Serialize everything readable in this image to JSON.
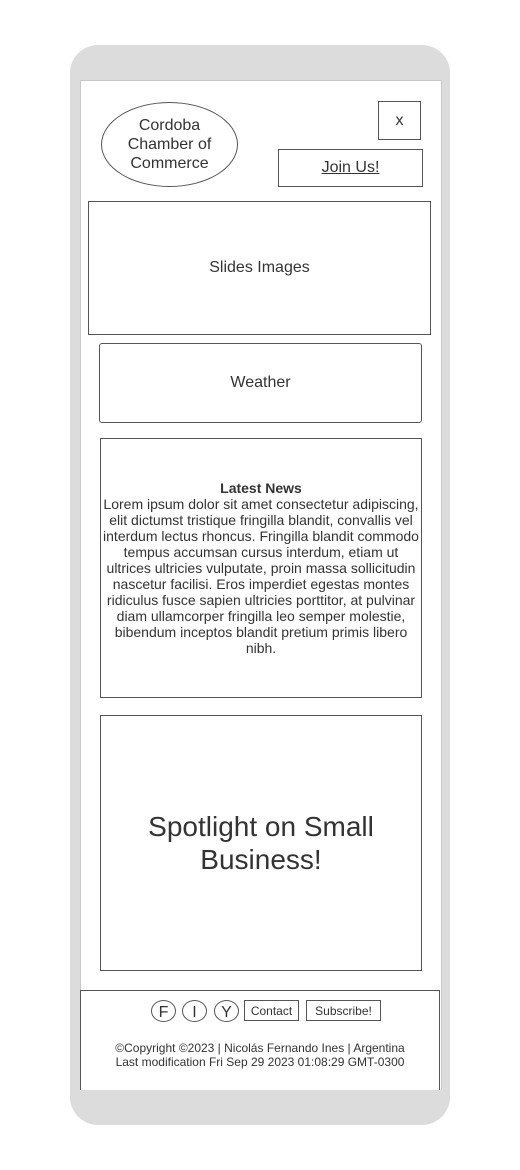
{
  "header": {
    "logo_text": "Cordoba Chamber of Commerce",
    "close_label": "x",
    "join_label": "Join Us!"
  },
  "main": {
    "slides_label": "Slides Images",
    "weather_label": "Weather",
    "news": {
      "title": "Latest News",
      "body": "Lorem ipsum dolor sit amet consectetur adipiscing, elit dictumst tristique fringilla blandit, convallis vel interdum lectus rhoncus. Fringilla blandit commodo tempus accumsan cursus interdum, etiam ut ultrices ultricies vulputate, proin massa sollicitudin nascetur facilisi. Eros imperdiet egestas montes ridiculus fusce sapien ultricies porttitor, at pulvinar diam ullamcorper fringilla leo semper molestie, bibendum inceptos blandit pretium primis libero nibh."
    },
    "spotlight_label": "Spotlight on Small Business!"
  },
  "footer": {
    "social": [
      {
        "label": "F",
        "icon": "facebook-icon"
      },
      {
        "label": "I",
        "icon": "instagram-icon"
      },
      {
        "label": "Y",
        "icon": "youtube-icon"
      }
    ],
    "contact_label": "Contact",
    "subscribe_label": "Subscribe!",
    "copyright": "©Copyright ©2023 | Nicolás Fernando Ines | Argentina",
    "last_modified": "Last modification Fri Sep 29 2023 01:08:29 GMT-0300"
  }
}
